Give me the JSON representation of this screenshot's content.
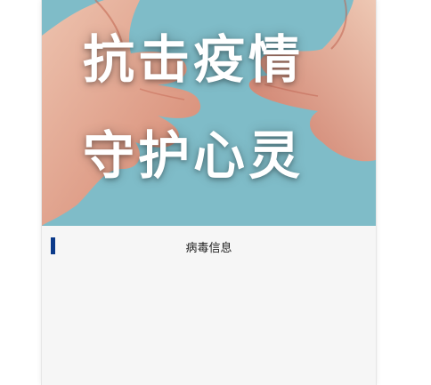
{
  "banner": {
    "line1": "抗击疫情",
    "line2": "守护心灵",
    "background_color": "#7fbcc8"
  },
  "section": {
    "title": "病毒信息",
    "accent_color": "#0b3a8a"
  }
}
